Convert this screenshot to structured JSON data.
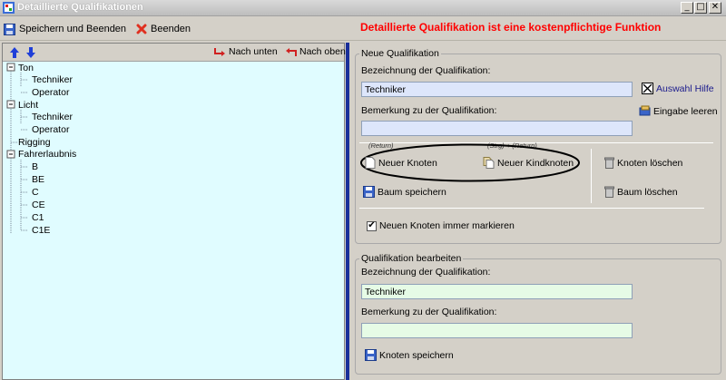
{
  "window": {
    "title": "Detaillierte Qualifikationen",
    "controls": [
      "_",
      "□",
      "✕"
    ]
  },
  "toolbar": {
    "save_close_label": "Speichern und Beenden",
    "close_label": "Beenden",
    "notice": "Detaillierte Qualifikation ist eine kostenpflichtige Funktion"
  },
  "tree_toolbar": {
    "down_label": "Nach unten",
    "up_label": "Nach oben"
  },
  "tree": {
    "nodes": [
      {
        "label": "Ton",
        "level": 0,
        "expanded": true
      },
      {
        "label": "Techniker",
        "level": 1
      },
      {
        "label": "Operator",
        "level": 1
      },
      {
        "label": "Licht",
        "level": 0,
        "expanded": true
      },
      {
        "label": "Techniker",
        "level": 1
      },
      {
        "label": "Operator",
        "level": 1
      },
      {
        "label": "Rigging",
        "level": 0
      },
      {
        "label": "Fahrerlaubnis",
        "level": 0,
        "expanded": true
      },
      {
        "label": "B",
        "level": 1
      },
      {
        "label": "BE",
        "level": 1
      },
      {
        "label": "C",
        "level": 1
      },
      {
        "label": "CE",
        "level": 1
      },
      {
        "label": "C1",
        "level": 1
      },
      {
        "label": "C1E",
        "level": 1
      }
    ]
  },
  "new_qual": {
    "legend": "Neue Qualifikation",
    "name_label": "Bezeichnung der Qualifikation:",
    "name_value": "Techniker",
    "remark_label": "Bemerkung zu der Qualifikation:",
    "remark_value": "",
    "help_label": "Auswahl Hilfe",
    "clear_label": "Eingabe leeren",
    "return_hint": "(Return)",
    "strg_hint": "(Strg) + (Return)",
    "new_node_label": "Neuer Knoten",
    "new_child_label": "Neuer Kindknoten",
    "delete_node_label": "Knoten löschen",
    "save_tree_label": "Baum speichern",
    "delete_tree_label": "Baum löschen",
    "mark_label": "Neuen Knoten immer markieren",
    "mark_checked": true
  },
  "edit_qual": {
    "legend": "Qualifikation bearbeiten",
    "name_label": "Bezeichnung der Qualifikation:",
    "name_value": "Techniker",
    "remark_label": "Bemerkung zu der Qualifikation:",
    "remark_value": "",
    "save_node_label": "Knoten speichern"
  },
  "colors": {
    "notice": "#ff0000",
    "tree_bg": "#e0fcff",
    "divider": "#1a2f9a",
    "help_link": "#1a1a8c"
  }
}
